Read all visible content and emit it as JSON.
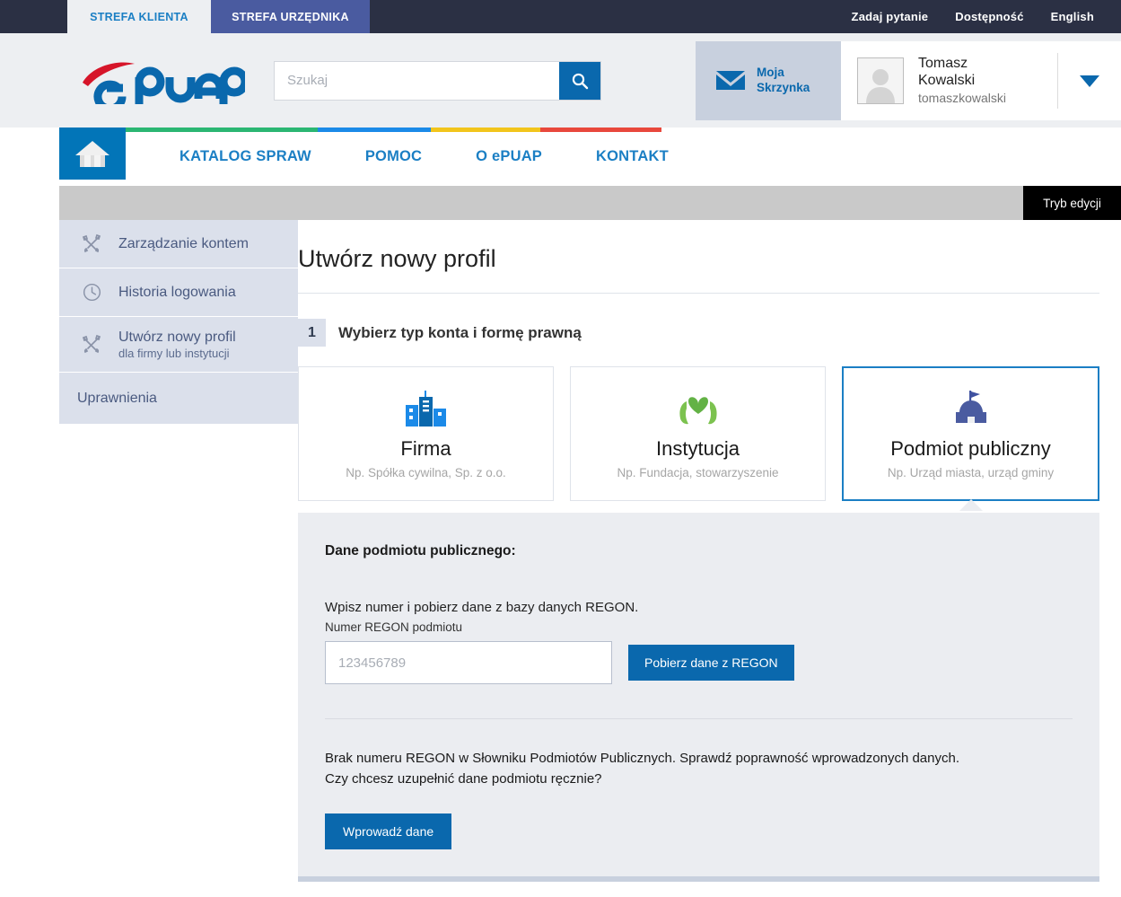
{
  "topbar": {
    "zones": [
      {
        "label": "STREFA KLIENTA",
        "active": false
      },
      {
        "label": "STREFA URZĘDNIKA",
        "active": true
      }
    ],
    "links": [
      "Zadaj pytanie",
      "Dostępność",
      "English"
    ]
  },
  "header": {
    "logo_text": "ePUAP",
    "search": {
      "placeholder": "Szukaj",
      "value": "",
      "icon": "search-icon"
    },
    "mailbox": {
      "label": "Moja\nSkrzynka",
      "icon": "envelope-icon"
    },
    "user": {
      "full_name": "Tomasz\nKowalski",
      "login": "tomaszkowalski",
      "avatar_icon": "user-avatar-icon",
      "caret_icon": "chevron-down-icon"
    }
  },
  "nav": {
    "home_icon": "home-icon",
    "links": [
      "KATALOG SPRAW",
      "POMOC",
      "O ePUAP",
      "KONTAKT"
    ],
    "stripe_colors": [
      "#2bb673",
      "#1b8ae8",
      "#f2c51c",
      "#e8483c"
    ]
  },
  "editbar": {
    "button_label": "Tryb edycji"
  },
  "sidebar": {
    "items": [
      {
        "label": "Zarządzanie kontem",
        "sub": "",
        "icon": "tools-icon"
      },
      {
        "label": "Historia logowania",
        "sub": "",
        "icon": "clock-icon"
      },
      {
        "label": "Utwórz nowy profil",
        "sub": "dla firmy lub instytucji",
        "icon": "tools-icon"
      },
      {
        "label": "Uprawnienia",
        "sub": "",
        "icon": ""
      }
    ]
  },
  "main": {
    "page_title": "Utwórz nowy profil",
    "step": {
      "number": "1",
      "title": "Wybierz typ konta i formę prawną"
    },
    "cards": [
      {
        "title": "Firma",
        "subtitle": "Np. Spółka cywilna, Sp. z o.o.",
        "icon": "office-buildings-icon",
        "selected": false
      },
      {
        "title": "Instytucja",
        "subtitle": "Np. Fundacja, stowarzyszenie",
        "icon": "heart-in-hands-icon",
        "selected": false
      },
      {
        "title": "Podmiot publiczny",
        "subtitle": "Np. Urząd miasta, urząd gminy",
        "icon": "government-building-icon",
        "selected": true
      }
    ],
    "form": {
      "heading": "Dane podmiotu publicznego:",
      "hint": "Wpisz numer i pobierz dane z bazy danych REGON.",
      "field_label": "Numer REGON podmiotu",
      "regon_placeholder": "123456789",
      "regon_value": "",
      "fetch_button": "Pobierz dane z REGON",
      "error_line1": "Brak numeru REGON w Słowniku Podmiotów Publicznych. Sprawdź poprawność wprowadzonych danych.",
      "error_line2": "Czy chcesz uzupełnić dane podmiotu ręcznie?",
      "enter_button": "Wprowadź dane"
    }
  },
  "colors": {
    "topbar_bg": "#2b3044",
    "accent_blue": "#0a68ad",
    "link_blue": "#1b7fc4",
    "officer_tab": "#4a5ba0",
    "panel_bg": "#ebedf1",
    "sidebar_item": "#dbe0eb",
    "logo_red": "#d6152a",
    "logo_blue": "#0a68ad"
  }
}
